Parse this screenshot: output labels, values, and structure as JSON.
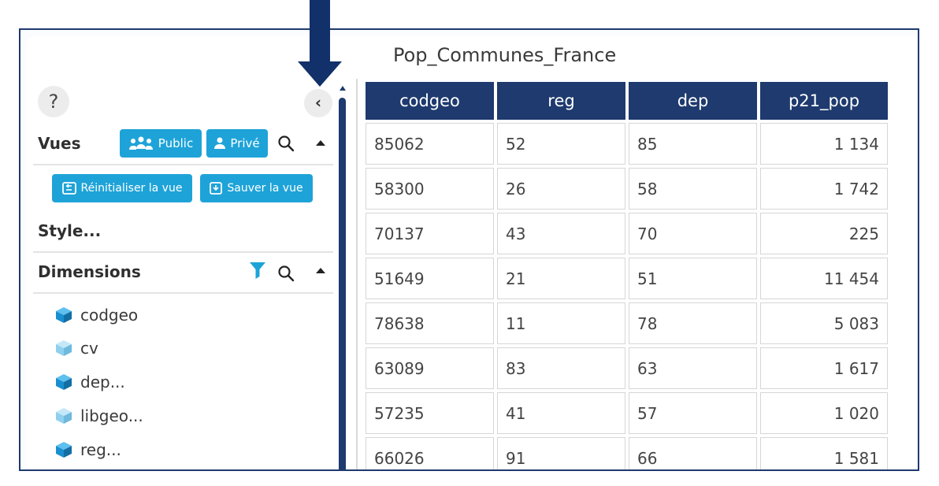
{
  "title": "Pop_Communes_France",
  "sidebar": {
    "help_label": "?",
    "collapse_label": "‹",
    "vues": {
      "label": "Vues",
      "public_label": "Public",
      "prive_label": "Privé",
      "reset_label": "Réinitialiser la vue",
      "save_label": "Sauver la vue"
    },
    "style_label": "Style...",
    "dimensions": {
      "label": "Dimensions",
      "items": [
        {
          "label": "codgeo",
          "shade": "dark"
        },
        {
          "label": "cv",
          "shade": "light"
        },
        {
          "label": "dep...",
          "shade": "dark"
        },
        {
          "label": "libgeo...",
          "shade": "light"
        },
        {
          "label": "reg...",
          "shade": "dark"
        }
      ]
    }
  },
  "table": {
    "columns": [
      "codgeo",
      "reg",
      "dep",
      "p21_pop"
    ],
    "rows": [
      [
        "85062",
        "52",
        "85",
        "1 134"
      ],
      [
        "58300",
        "26",
        "58",
        "1 742"
      ],
      [
        "70137",
        "43",
        "70",
        "225"
      ],
      [
        "51649",
        "21",
        "51",
        "11 454"
      ],
      [
        "78638",
        "11",
        "78",
        "5 083"
      ],
      [
        "63089",
        "83",
        "63",
        "1 617"
      ],
      [
        "57235",
        "41",
        "57",
        "1 020"
      ],
      [
        "66026",
        "91",
        "66",
        "1 581"
      ]
    ]
  },
  "colors": {
    "header_bg": "#1e3a6e",
    "button_bg": "#1ea3d8",
    "cube_dark": "#1a8fd0",
    "cube_light": "#8fd0ef",
    "filter": "#1ea3d8"
  }
}
